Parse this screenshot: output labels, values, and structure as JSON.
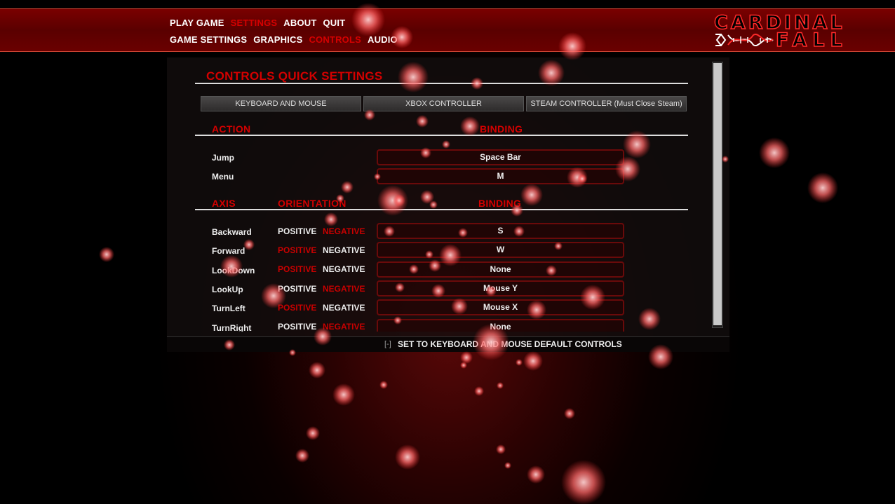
{
  "nav": {
    "row1": [
      {
        "label": "PLAY GAME",
        "active": false
      },
      {
        "label": "SETTINGS",
        "active": true
      },
      {
        "label": "ABOUT",
        "active": false
      },
      {
        "label": "QUIT",
        "active": false
      }
    ],
    "row2": [
      {
        "label": "GAME SETTINGS",
        "active": false
      },
      {
        "label": "GRAPHICS",
        "active": false
      },
      {
        "label": "CONTROLS",
        "active": true
      },
      {
        "label": "AUDIO",
        "active": false
      }
    ]
  },
  "logo": {
    "line1": "CARDINAL",
    "line2": "FALL",
    "icon": "dna-icon"
  },
  "panel": {
    "title": "CONTROLS QUICK SETTINGS",
    "tabs": [
      "KEYBOARD AND MOUSE",
      "XBOX CONTROLLER",
      "STEAM CONTROLLER (Must Close Steam)"
    ],
    "action_header": {
      "action": "ACTION",
      "binding": "BINDING"
    },
    "actions": [
      {
        "name": "Jump",
        "binding": "Space Bar"
      },
      {
        "name": "Menu",
        "binding": "M"
      }
    ],
    "axis_header": {
      "axis": "AXIS",
      "orientation": "ORIENTATION",
      "binding": "BINDING"
    },
    "axes": [
      {
        "name": "Backward",
        "positive": "POSITIVE",
        "negative": "NEGATIVE",
        "selected": "positive",
        "binding": "S"
      },
      {
        "name": "Forward",
        "positive": "POSITIVE",
        "negative": "NEGATIVE",
        "selected": "negative",
        "binding": "W"
      },
      {
        "name": "LookDown",
        "positive": "POSITIVE",
        "negative": "NEGATIVE",
        "selected": "negative",
        "binding": "None"
      },
      {
        "name": "LookUp",
        "positive": "POSITIVE",
        "negative": "NEGATIVE",
        "selected": "positive",
        "binding": "Mouse Y"
      },
      {
        "name": "TurnLeft",
        "positive": "POSITIVE",
        "negative": "NEGATIVE",
        "selected": "negative",
        "binding": "Mouse X"
      },
      {
        "name": "TurnRight",
        "positive": "POSITIVE",
        "negative": "NEGATIVE",
        "selected": "positive",
        "binding": "None"
      }
    ],
    "default_key": "[-]",
    "default_label": "SET TO KEYBOARD AND MOUSE DEFAULT CONTROLS"
  },
  "colors": {
    "accent": "#d40000",
    "bar": "#6a0000",
    "particle": "#ff5a5a"
  }
}
